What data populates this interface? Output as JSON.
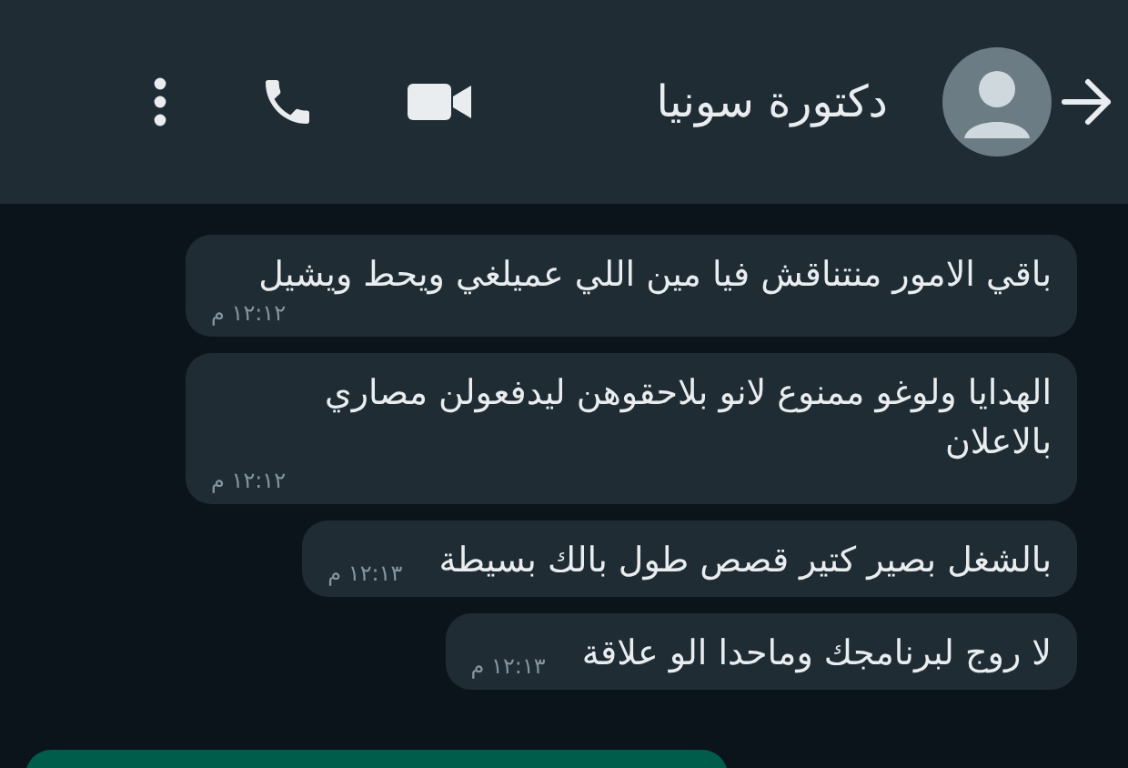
{
  "header": {
    "title": "دكتورة سونيا"
  },
  "messages": [
    {
      "text": "باقي الامور منتناقش فيا مين اللي عميلغي ويحط ويشيل",
      "time": "١٢:١٢ م"
    },
    {
      "text": "الهدايا ولوغو ممنوع لانو بلاحقوهن ليدفعولن مصاري بالاعلان",
      "time": "١٢:١٢ م"
    },
    {
      "text": "بالشغل بصير كتير قصص طول بالك بسيطة",
      "time": "١٢:١٣ م"
    },
    {
      "text": "لا روج لبرنامجك وماحدا الو علاقة",
      "time": "١٢:١٣ م"
    }
  ]
}
